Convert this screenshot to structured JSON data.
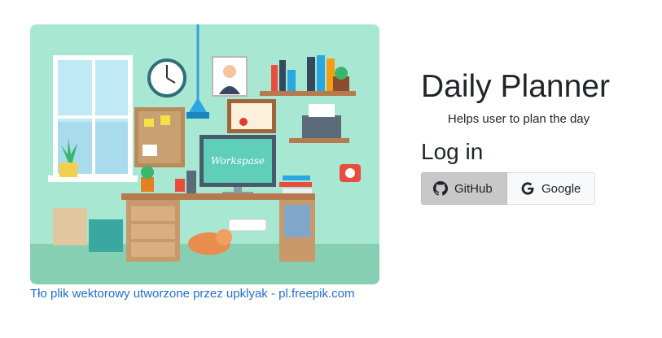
{
  "hero": {
    "screen_text": "Workspase",
    "credit_link": "Tło plik wektorowy utworzone przez upklyak - pl.freepik.com"
  },
  "panel": {
    "title": "Daily Planner",
    "tagline": "Helps user to plan the day",
    "login_heading": "Log in",
    "buttons": [
      {
        "label": "GitHub",
        "icon": "github-icon"
      },
      {
        "label": "Google",
        "icon": "google-icon"
      }
    ]
  },
  "colors": {
    "background_mint": "#a8e8d3",
    "link_blue": "#1f6fd1",
    "github_button_bg": "#c8c8c8",
    "google_button_bg": "#f8f9fa"
  }
}
